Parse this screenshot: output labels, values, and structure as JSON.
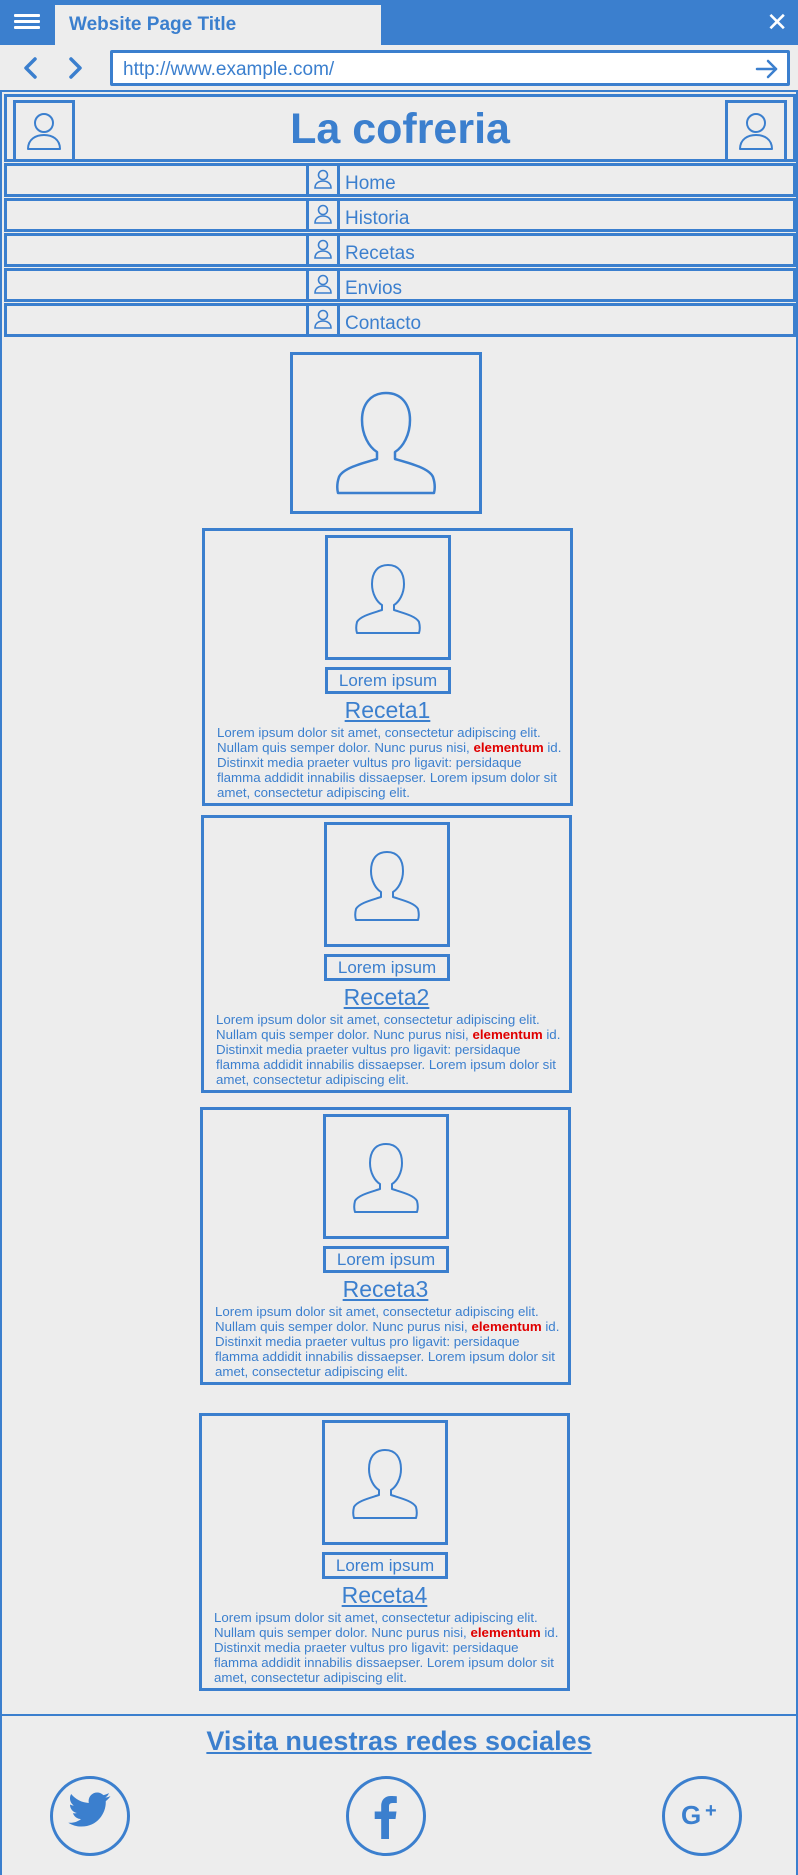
{
  "browser": {
    "tab_title": "Website Page Title",
    "url": "http://www.example.com/",
    "icons": [
      "menu-icon",
      "close-icon",
      "back-arrow-icon",
      "forward-arrow-icon",
      "go-arrow-icon"
    ]
  },
  "header": {
    "title": "La cofreria",
    "left_icon": "user-icon",
    "right_icon": "user-icon"
  },
  "menu": {
    "items": [
      {
        "label": "Home",
        "icon": "user-icon"
      },
      {
        "label": "Historia",
        "icon": "user-icon"
      },
      {
        "label": "Recetas",
        "icon": "user-icon"
      },
      {
        "label": "Envios",
        "icon": "user-icon"
      },
      {
        "label": "Contacto",
        "icon": "user-icon"
      }
    ]
  },
  "main_image": {
    "icon": "user-icon"
  },
  "cards": [
    {
      "button": "Lorem ipsum",
      "title": "Receta1",
      "text_a": "Lorem ipsum dolor sit amet, consectetur adipiscing elit. Nullam quis semper dolor. Nunc purus nisi, ",
      "highlight": "elementum",
      "text_b": " id. Distinxit  media praeter vultus pro ligavit: persidaque flamma addidit innabilis dissaepser. Lorem ipsum dolor sit amet, consectetur adipiscing elit."
    },
    {
      "button": "Lorem ipsum",
      "title": "Receta2",
      "text_a": "Lorem ipsum dolor sit amet, consectetur adipiscing elit. Nullam quis semper dolor. Nunc purus nisi, ",
      "highlight": "elementum",
      "text_b": " id. Distinxit  media praeter vultus pro ligavit: persidaque flamma addidit innabilis dissaepser. Lorem ipsum dolor sit amet, consectetur adipiscing elit."
    },
    {
      "button": "Lorem ipsum",
      "title": "Receta3",
      "text_a": "Lorem ipsum dolor sit amet, consectetur adipiscing elit. Nullam quis semper dolor. Nunc purus nisi, ",
      "highlight": "elementum",
      "text_b": " id. Distinxit  media praeter vultus pro ligavit: persidaque flamma addidit innabilis dissaepser. Lorem ipsum dolor sit amet, consectetur adipiscing elit."
    },
    {
      "button": "Lorem ipsum",
      "title": "Receta4",
      "text_a": "Lorem ipsum dolor sit amet, consectetur adipiscing elit. Nullam quis semper dolor. Nunc purus nisi, ",
      "highlight": "elementum",
      "text_b": " id. Distinxit  media praeter vultus pro ligavit: persidaque flamma addidit innabilis dissaepser. Lorem ipsum dolor sit amet, consectetur adipiscing elit."
    }
  ],
  "footer": {
    "social_title": "Visita nuestras redes sociales",
    "social_icons": [
      "twitter-icon",
      "facebook-icon",
      "google-plus-icon"
    ]
  },
  "colors": {
    "accent": "#3b7fce",
    "background": "#ededed",
    "highlight": "#e00000"
  }
}
